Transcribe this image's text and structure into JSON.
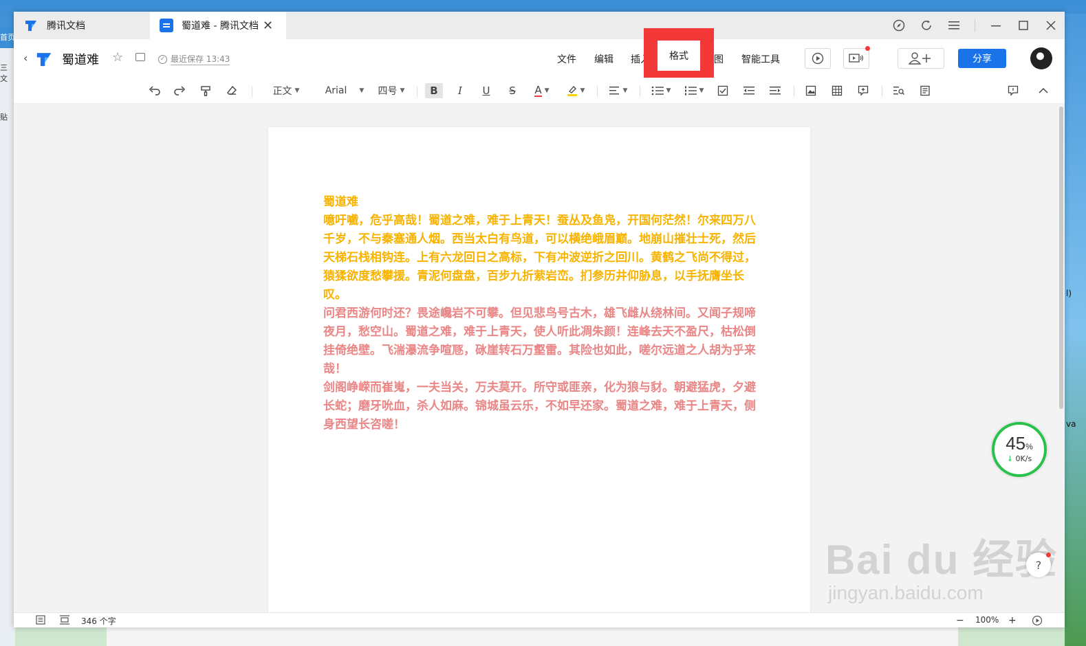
{
  "desktop": {
    "left_labels": [
      "首页",
      "三 文",
      "贴"
    ],
    "right_labels": [
      "l)",
      "va"
    ]
  },
  "tabs": [
    {
      "label": "腾讯文档"
    },
    {
      "label": "蜀道难 - 腾讯文档",
      "close": "✕"
    }
  ],
  "header": {
    "doc_title": "蜀道难",
    "saved": "最近保存 13:43",
    "menus": [
      "文件",
      "编辑",
      "插入",
      "格式",
      "视图",
      "智能工具"
    ],
    "share_label": "分享"
  },
  "toolbar": {
    "style": "正文",
    "font": "Arial",
    "size": "四号",
    "bold": "B",
    "italic": "I",
    "underline": "U",
    "strike": "S",
    "font_color": "A"
  },
  "document": {
    "colors": {
      "title": "#f7b300",
      "body2": "#ea8686"
    },
    "title": "蜀道难",
    "p1": "噫吁嚱，危乎高哉！蜀道之难，难于上青天！蚕丛及鱼凫，开国何茫然！尔来四万八千岁，不与秦塞通人烟。西当太白有鸟道，可以横绝峨眉巅。地崩山摧壮士死，然后天梯石栈相钩连。上有六龙回日之高标，下有冲波逆折之回川。黄鹤之飞尚不得过，猿猱欲度愁攀援。青泥何盘盘，百步九折萦岩峦。扪参历井仰胁息，以手抚膺坐长叹。",
    "p2": "问君西游何时还？畏途巉岩不可攀。但见悲鸟号古木，雄飞雌从绕林间。又闻子规啼夜月，愁空山。蜀道之难，难于上青天，使人听此凋朱颜！连峰去天不盈尺，枯松倒挂倚绝壁。飞湍瀑流争喧豗，砯崖转石万壑雷。其险也如此，嗟尔远道之人胡为乎来哉！",
    "p3": "剑阁峥嵘而崔嵬，一夫当关，万夫莫开。所守或匪亲，化为狼与豺。朝避猛虎，夕避长蛇；磨牙吮血，杀人如麻。锦城虽云乐，不如早还家。蜀道之难，难于上青天，侧身西望长咨嗟！"
  },
  "status": {
    "word_count": "346 个字",
    "zoom": "100%"
  },
  "speed_widget": {
    "percent": "45",
    "percent_sign": "%",
    "rate": "0K/s"
  },
  "help_label": "?",
  "watermark": {
    "line1": "Bai du 经验",
    "line2": "jingyan.baidu.com"
  }
}
